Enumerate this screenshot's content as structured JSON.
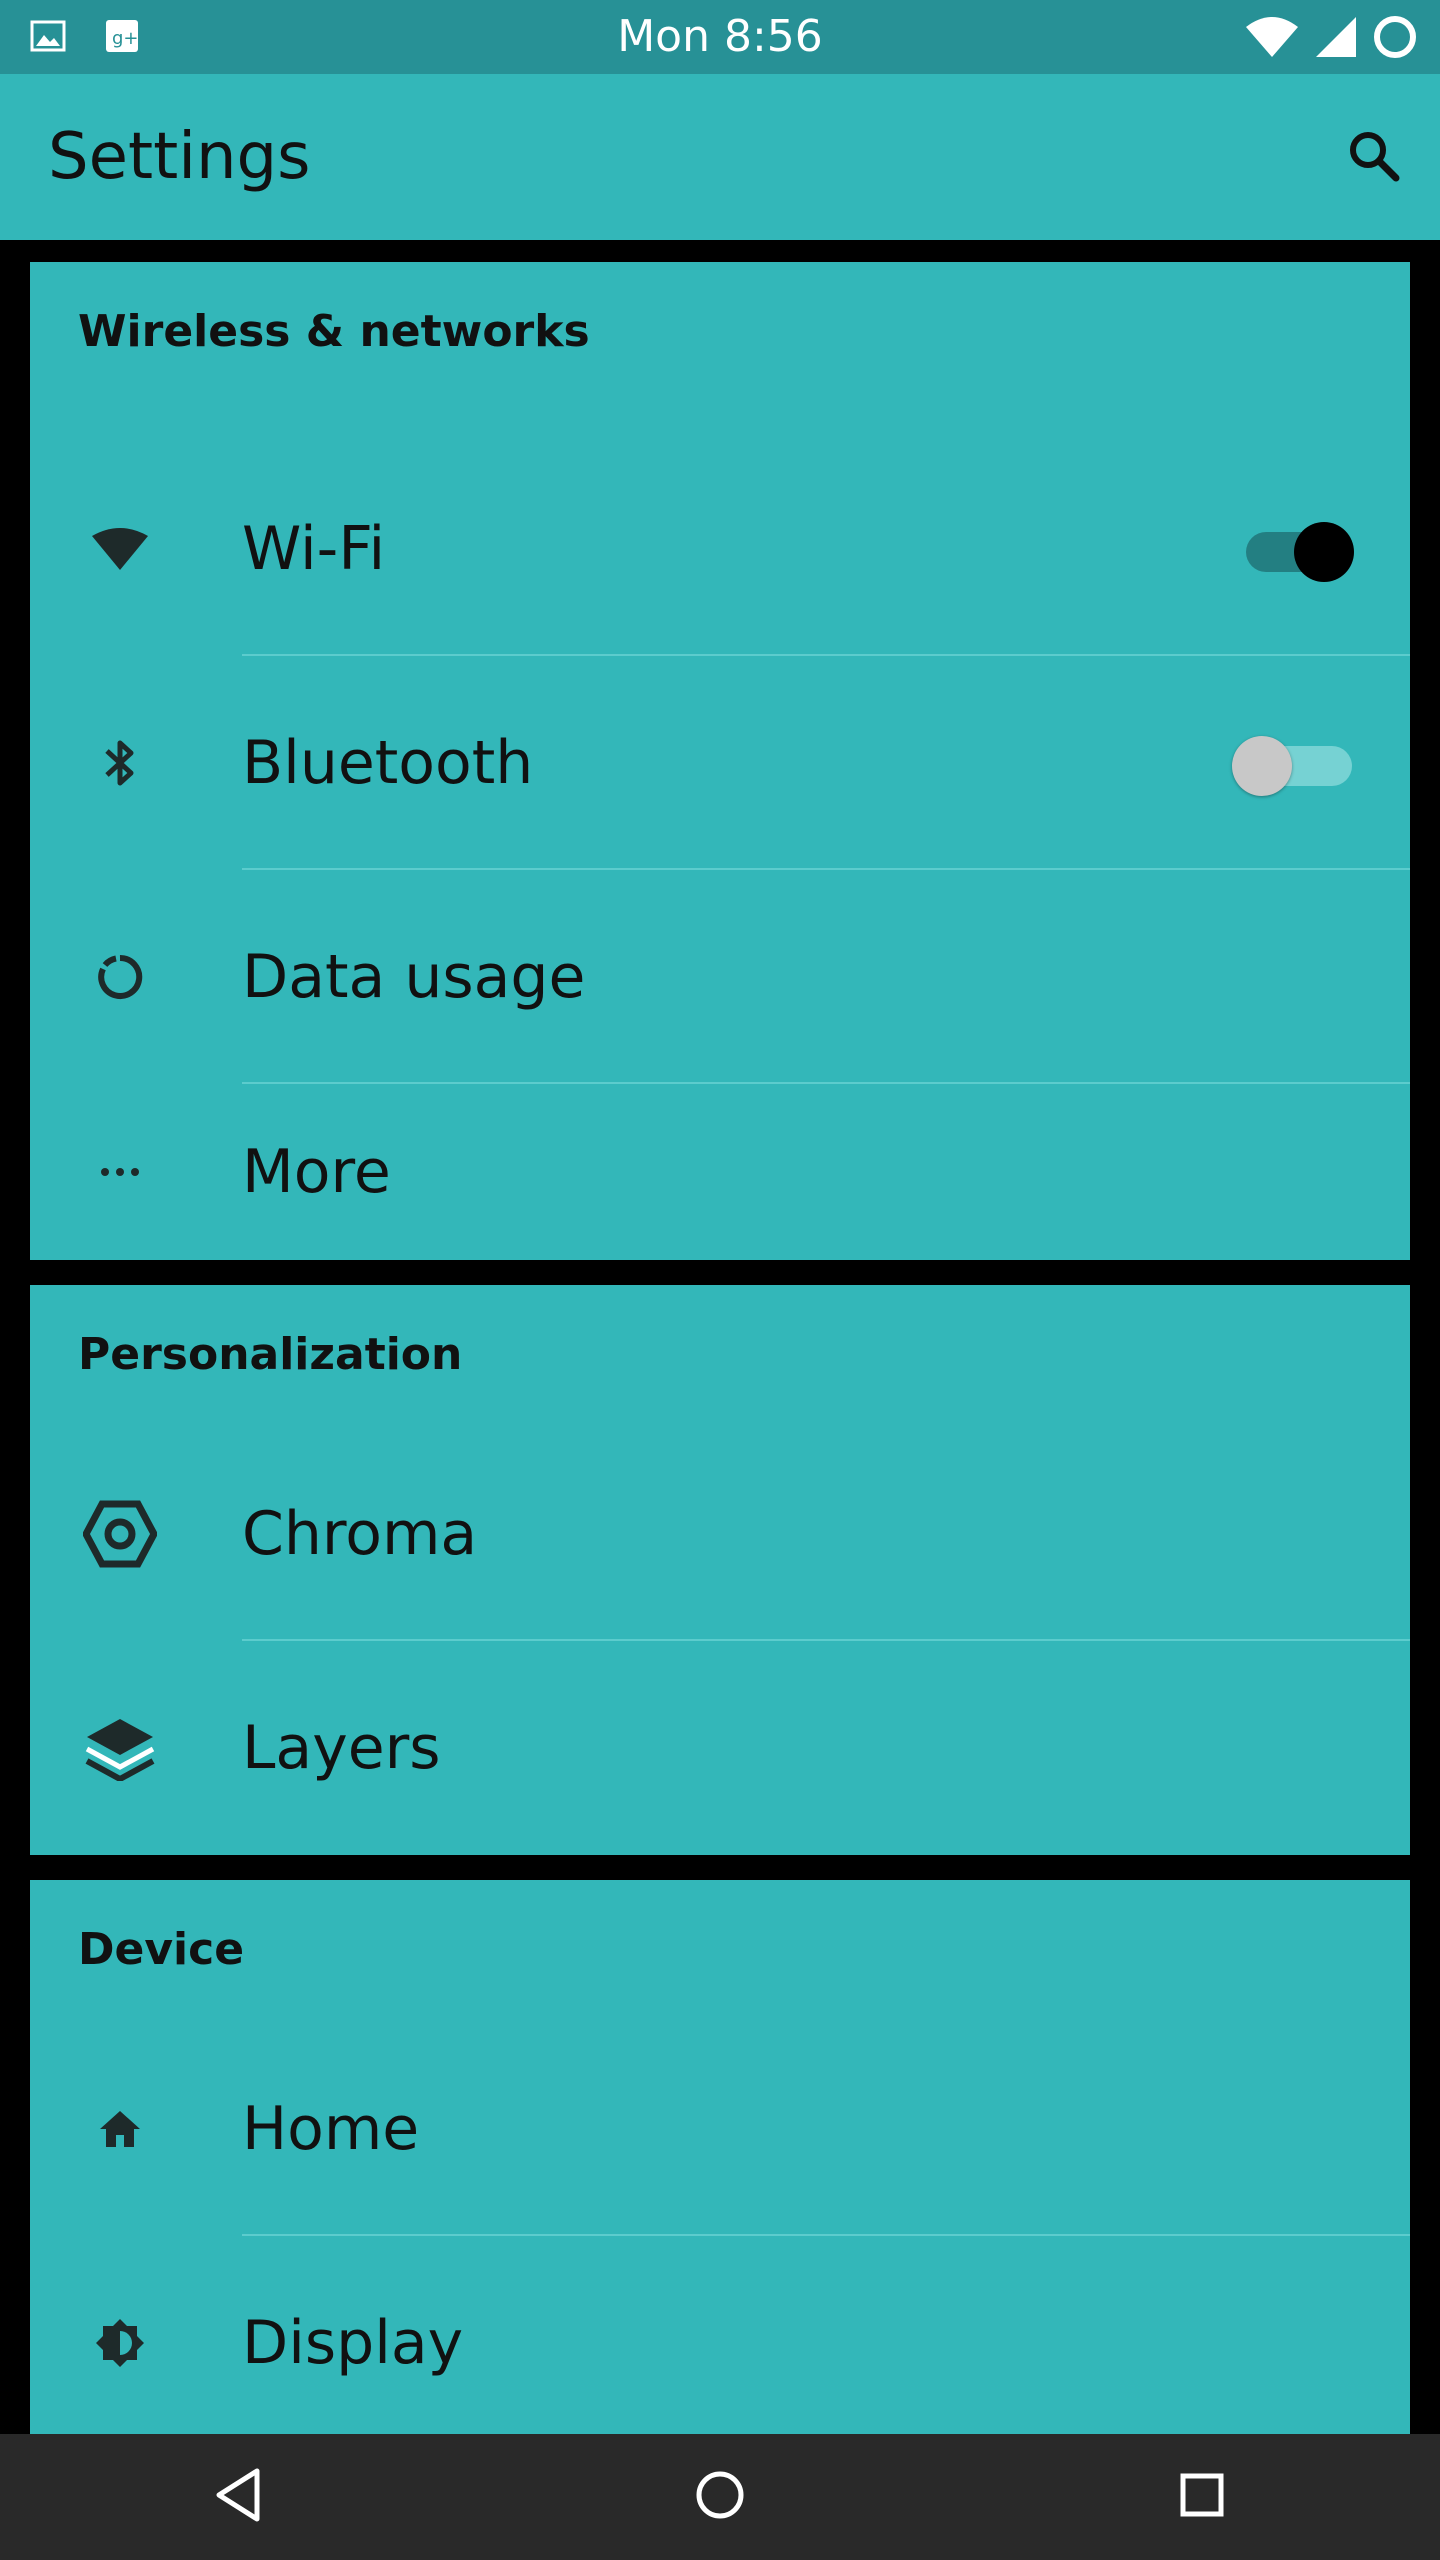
{
  "status_bar": {
    "time": "Mon 8:56",
    "left_icons": [
      "image-icon",
      "google-plus-icon"
    ],
    "right_icons": [
      "wifi-signal-icon",
      "cell-signal-icon",
      "battery-ring-icon"
    ]
  },
  "app_bar": {
    "title": "Settings",
    "search_icon": "search-icon"
  },
  "sections": [
    {
      "header": "Wireless & networks",
      "items": [
        {
          "label": "Wi-Fi",
          "icon": "wifi-icon",
          "toggle": "on"
        },
        {
          "label": "Bluetooth",
          "icon": "bluetooth-icon",
          "toggle": "off"
        },
        {
          "label": "Data usage",
          "icon": "data-usage-icon"
        },
        {
          "label": "More",
          "icon": "more-dots-icon"
        }
      ]
    },
    {
      "header": "Personalization",
      "items": [
        {
          "label": "Chroma",
          "icon": "hexagon-icon"
        },
        {
          "label": "Layers",
          "icon": "layers-icon"
        }
      ]
    },
    {
      "header": "Device",
      "items": [
        {
          "label": "Home",
          "icon": "home-icon"
        },
        {
          "label": "Display",
          "icon": "brightness-icon"
        }
      ]
    }
  ],
  "nav_bar": {
    "buttons": [
      "back-icon",
      "home-circle-icon",
      "recents-icon"
    ]
  },
  "colors": {
    "status_bar": "#279196",
    "accent": "#33b7b9",
    "divider": "#5ccccd",
    "nav_bar": "#292929",
    "text": "#111111"
  }
}
